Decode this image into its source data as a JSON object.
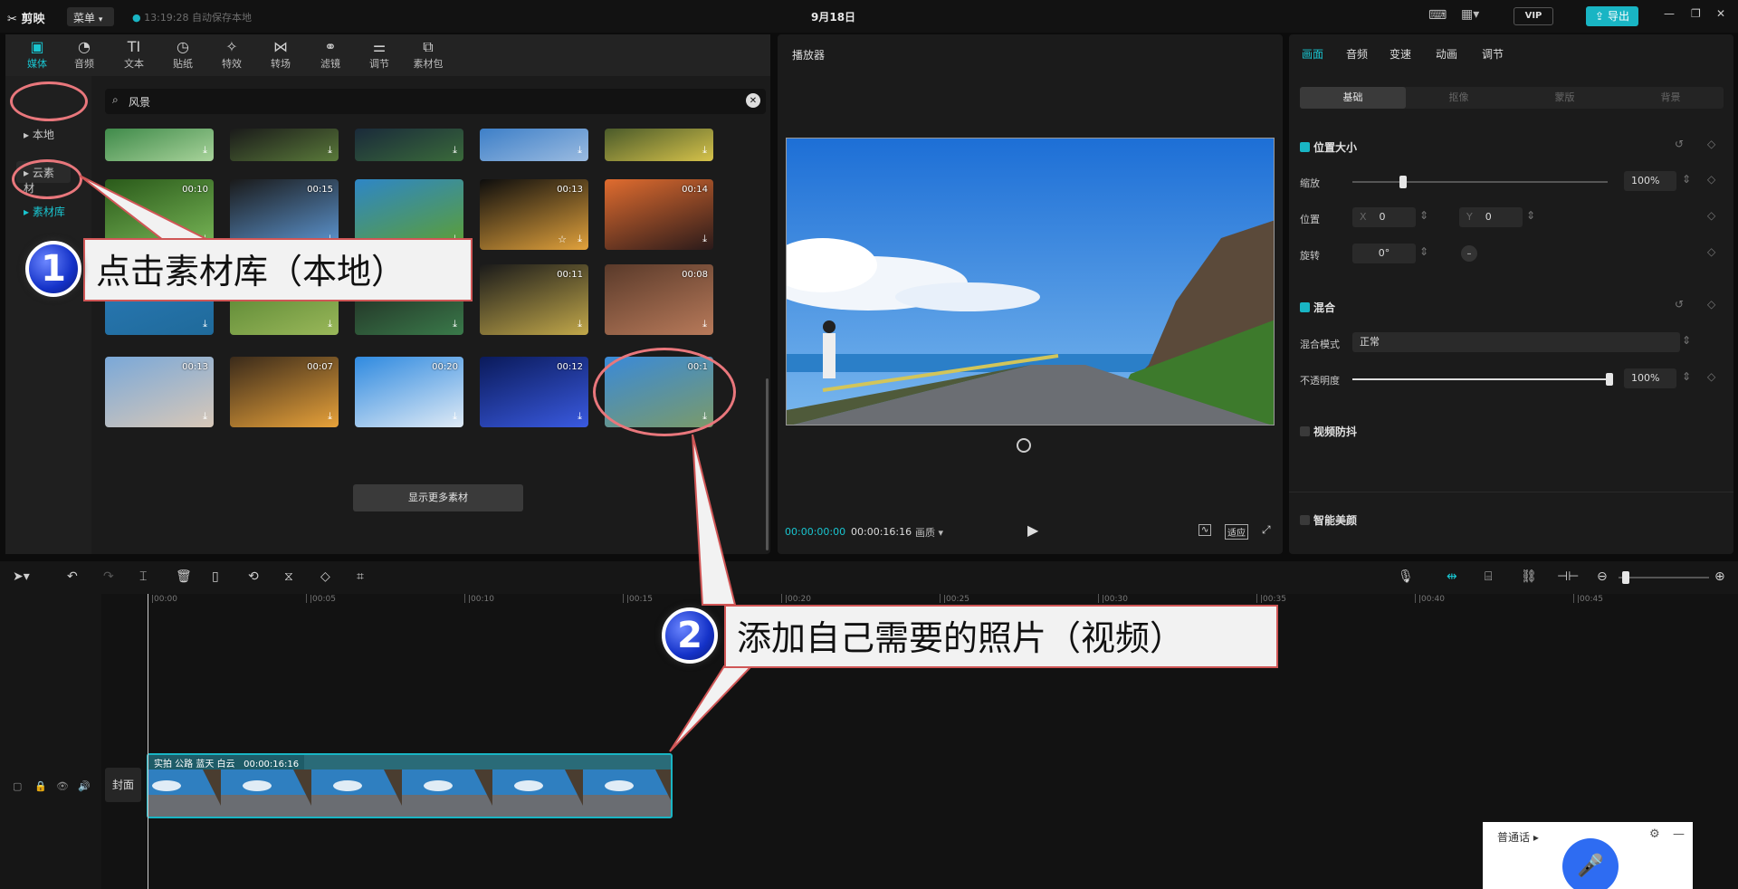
{
  "topbar": {
    "app_name": "剪映",
    "menu": "菜单",
    "save_status": "13:19:28 自动保存本地",
    "project_title": "9月18日",
    "vip": "VIP",
    "export": "导出"
  },
  "media": {
    "tabs": [
      "媒体",
      "音频",
      "文本",
      "贴纸",
      "特效",
      "转场",
      "滤镜",
      "调节",
      "素材包"
    ],
    "sidebar": [
      "本地",
      "云素材",
      "素材库"
    ],
    "search_value": "风景",
    "grid": [
      {
        "dur": "",
        "dl": true
      },
      {
        "dur": "",
        "dl": true
      },
      {
        "dur": "",
        "dl": true
      },
      {
        "dur": "",
        "dl": false
      },
      {
        "dur": "",
        "dl": false
      },
      {
        "dur": "00:10",
        "dl": false
      },
      {
        "dur": "00:15",
        "dl": false
      },
      {
        "dur": "",
        "dl": false
      },
      {
        "dur": "00:13",
        "dl": true
      },
      {
        "dur": "00:14",
        "dl": false
      },
      {
        "dur": "",
        "dl": true
      },
      {
        "dur": "",
        "dl": false
      },
      {
        "dur": "",
        "dl": true
      },
      {
        "dur": "00:11",
        "dl": true
      },
      {
        "dur": "00:08",
        "dl": true
      },
      {
        "dur": "00:13",
        "dl": false
      },
      {
        "dur": "00:07",
        "dl": false
      },
      {
        "dur": "00:20",
        "dl": false
      },
      {
        "dur": "00:12",
        "dl": true
      },
      {
        "dur": "00:1",
        "dl": false
      }
    ],
    "more_button": "显示更多素材"
  },
  "player": {
    "header": "播放器",
    "current_time": "00:00:00:00",
    "total_time": "00:00:16:16",
    "quality": "画质",
    "fit": "适应"
  },
  "inspector": {
    "tabs": [
      "画面",
      "音频",
      "变速",
      "动画",
      "调节"
    ],
    "subtabs": [
      "基础",
      "抠像",
      "蒙版",
      "背景"
    ],
    "position_size": "位置大小",
    "scale_label": "缩放",
    "scale_value": "100%",
    "position_label": "位置",
    "pos_x_label": "X",
    "pos_x": "0",
    "pos_y_label": "Y",
    "pos_y": "0",
    "rotate_label": "旋转",
    "rotate_value": "0°",
    "blend": "混合",
    "blend_mode_label": "混合模式",
    "blend_mode_value": "正常",
    "opacity_label": "不透明度",
    "opacity_value": "100%",
    "stabilize": "视频防抖",
    "beauty": "智能美颜"
  },
  "timeline": {
    "ticks": [
      "00:00",
      "00:05",
      "00:10",
      "00:15",
      "00:20",
      "00:25",
      "00:30",
      "00:35",
      "00:40",
      "00:45"
    ],
    "clip_name": "实拍 公路 蓝天 白云",
    "clip_duration": "00:00:16:16",
    "cover": "封面"
  },
  "callouts": {
    "step1_number": "1",
    "step1_text": "点击素材库（本地）",
    "step2_number": "2",
    "step2_text": "添加自己需要的照片（视频）"
  },
  "voice": {
    "mode": "普通话"
  },
  "colors": {
    "accent": "#19c5d0",
    "annotation": "#e9777c",
    "badge_blue": "#1432c8"
  }
}
